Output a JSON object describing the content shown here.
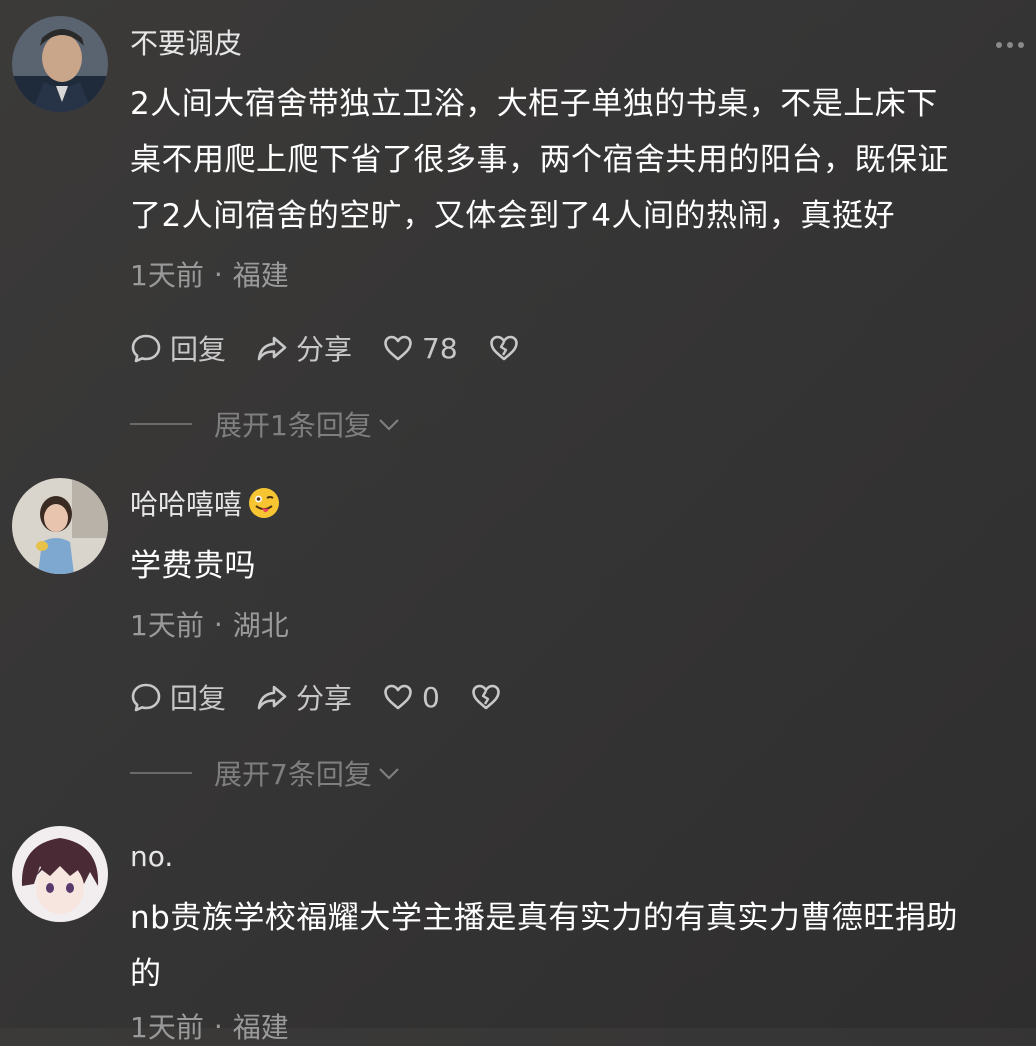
{
  "comments": [
    {
      "username": "不要调皮",
      "avatar_icon": "avatar-uniformed-man",
      "lines": [
        "2人间大宿舍带独立卫浴，大柜子单独的书桌，不是上床下",
        "桌不用爬上爬下省了很多事，两个宿舍共用的阳台，既保证",
        "了2人间宿舍的空旷，又体会到了4人间的热闹，真挺好"
      ],
      "time": "1天前",
      "separator": "·",
      "location": "福建",
      "reply_label": "回复",
      "share_label": "分享",
      "likes": "78",
      "expand_label": "展开1条回复"
    },
    {
      "username": "哈哈嘻嘻",
      "avatar_icon": "avatar-little-girl",
      "emoji_icon": "winking-tongue-emoji",
      "lines": [
        "学费贵吗"
      ],
      "time": "1天前",
      "separator": "·",
      "location": "湖北",
      "reply_label": "回复",
      "share_label": "分享",
      "likes": "0",
      "expand_label": "展开7条回复"
    },
    {
      "username": "no.",
      "avatar_icon": "avatar-anime-boy",
      "lines": [
        "nb贵族学校福耀大学主播是真有实力的有真实力曹德旺捐助",
        "的"
      ],
      "time": "1天前",
      "separator": "·",
      "location": "福建"
    }
  ],
  "colors": {
    "background": "#363535",
    "text": "#ffffff",
    "meta": "#9a9a9a",
    "muted": "#7f7f7f"
  }
}
